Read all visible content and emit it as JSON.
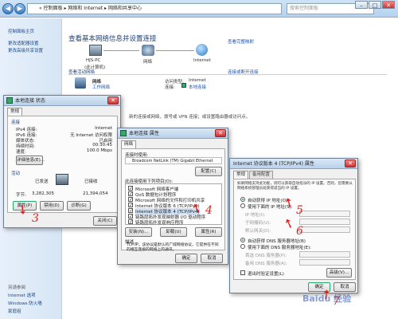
{
  "window": {
    "address_path": "« 控制面板 ▸ 网络和 Internet ▸ 网络和共享中心",
    "search_placeholder": "搜索控制面板",
    "controls": [
      "–",
      "□",
      "✕"
    ]
  },
  "sidebar": {
    "top_links": [
      "控制面板主页",
      "更改适配器设置",
      "更改高级共享设置"
    ],
    "see_also_label": "另请参阅",
    "bottom_links": [
      "Internet 选项",
      "Windows 防火墙",
      "家庭组"
    ]
  },
  "content": {
    "title": "查看基本网络信息并设置连接",
    "view_full_map": "查看完整映射",
    "nodes": [
      {
        "label": "HJS-PC",
        "sub": "(此计算机)"
      },
      {
        "label": "网络",
        "sub": ""
      },
      {
        "label": "Internet",
        "sub": ""
      }
    ],
    "active_networks_label": "查看活动网络",
    "connect_or_disconnect": "连接或断开连接",
    "network_name": "网络",
    "network_type": "工作网络",
    "access_type_label": "访问类型:",
    "access_type_value": "Internet",
    "connections_label": "连接:",
    "connections_value": "本地连接",
    "setup_text": "新的连接或网络，拨号或 VPN 连接；或设置路由器或访问点。"
  },
  "status_dialog": {
    "title": "本地连接 状态",
    "tab": "常规",
    "group_connection": "连接",
    "rows": [
      {
        "label": "IPv4 连接:",
        "value": "Internet"
      },
      {
        "label": "IPv6 连接:",
        "value": "无 Internet 访问权限"
      },
      {
        "label": "媒体状态:",
        "value": "已启用"
      },
      {
        "label": "持续时间:",
        "value": "00:30:45"
      },
      {
        "label": "速度:",
        "value": "100.0 Mbps"
      }
    ],
    "details_button": "详细信息(E)...",
    "group_activity": "活动",
    "sent_label": "已发送",
    "received_label": "已接收",
    "bytes_label": "字节:",
    "bytes_sent": "3,282,305",
    "bytes_received": "21,394,054",
    "properties_button": "属性(P)",
    "disable_button": "禁用(D)",
    "diagnose_button": "诊断(G)",
    "close_button": "关闭(C)"
  },
  "props_dialog": {
    "title": "本地连接 属性",
    "tab": "网络",
    "connect_using_label": "连接时使用:",
    "adapter": "Broadcom NetLink (TM) Gigabit Ethernet",
    "configure_button": "配置(C)",
    "items_label": "此连接使用下列项目(O):",
    "items": [
      "Microsoft 网络客户端",
      "QoS 数据包计划程序",
      "Microsoft 网络的文件和打印机共享",
      "Internet 协议版本 6 (TCP/IPv6)",
      "Internet 协议版本 4 (TCP/IPv4)",
      "链路层拓扑发现映射器 I/O 驱动程序",
      "链路层拓扑发现响应程序"
    ],
    "install_button": "安装(N)...",
    "uninstall_button": "卸载(U)",
    "properties_button": "属性(R)",
    "description_label": "描述",
    "description_text": "TCP/IP。该协议是默认的广域网络协议，它提供在不同的相互连接的网络上的通讯。",
    "ok_button": "确定",
    "cancel_button": "取消"
  },
  "ipv4_dialog": {
    "title": "Internet 协议版本 4 (TCP/IPv4) 属性",
    "tabs": [
      "常规",
      "备用配置"
    ],
    "intro": "如果网络支持此功能，则可以获取自动指派的 IP 设置。否则，您需要从网络系统管理员处获得适当的 IP 设置。",
    "auto_ip": "自动获得 IP 地址(O)",
    "manual_ip": "使用下面的 IP 地址(S):",
    "ip_label": "IP 地址(I):",
    "mask_label": "子网掩码(U):",
    "gateway_label": "默认网关(D):",
    "auto_dns": "自动获得 DNS 服务器地址(B)",
    "manual_dns": "使用下面的 DNS 服务器地址(E):",
    "pref_dns_label": "首选 DNS 服务器(P):",
    "alt_dns_label": "备用 DNS 服务器(A):",
    "validate_label": "退出时验证设置(L)",
    "advanced_button": "高级(V)...",
    "ok_button": "确定",
    "cancel_button": "取消"
  },
  "annotations": [
    "3",
    "4",
    "5",
    "6",
    "7"
  ],
  "watermark": "Baidu 经验"
}
